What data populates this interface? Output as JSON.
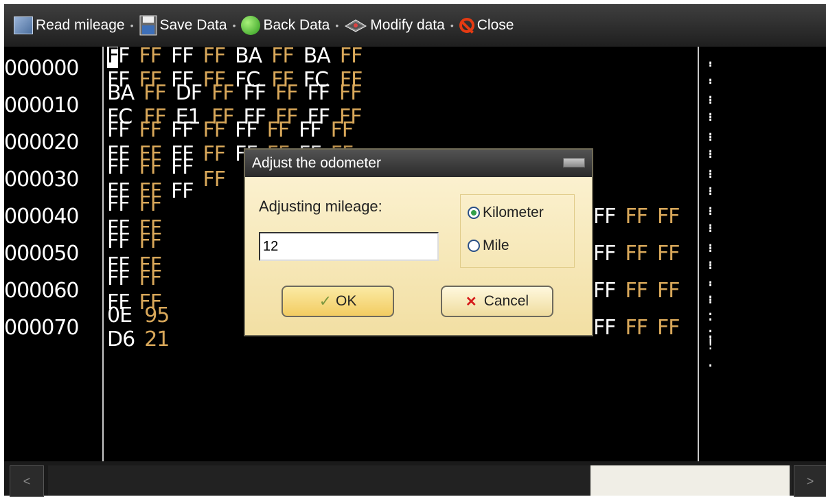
{
  "toolbar": {
    "items": [
      {
        "label": "Read mileage",
        "icon": "read-mileage-icon"
      },
      {
        "label": "Save Data",
        "icon": "floppy-disk-icon"
      },
      {
        "label": "Back Data",
        "icon": "green-refresh-icon"
      },
      {
        "label": "Modify data",
        "icon": "chip-icon"
      },
      {
        "label": "Close",
        "icon": "no-entry-icon"
      }
    ],
    "separator": "•"
  },
  "editor": {
    "rows": [
      {
        "addr": "000000",
        "bytes": [
          "FF",
          "FF",
          "FF",
          "FF",
          "FF",
          "FF",
          "FF",
          "FF",
          "BA",
          "FC",
          "FF",
          "FF",
          "BA",
          "FC",
          "FF",
          "FF"
        ],
        "ascii": "_ . . . . ."
      },
      {
        "addr": "000010",
        "bytes": [
          "BA",
          "FC",
          "FF",
          "FF",
          "DF",
          "E1",
          "FF",
          "FF",
          "FF",
          "FF",
          "FF",
          "FF",
          "FF",
          "FF",
          "FF",
          "FF"
        ],
        "ascii": ". . . . . ."
      },
      {
        "addr": "000020",
        "bytes": [
          "FF",
          "FF",
          "FF",
          "FF",
          "FF",
          "FF",
          "FF",
          "FF",
          "FF",
          "FF",
          "FF",
          "FF",
          "FF",
          "FF",
          "FF",
          "FF"
        ],
        "ascii": ". . . . . ."
      },
      {
        "addr": "000030",
        "bytes": [
          "FF",
          "FF",
          "FF",
          "FF",
          "",
          "",
          "",
          "",
          "",
          "",
          "",
          "",
          "",
          "",
          "FF",
          "FF",
          "FF"
        ],
        "ascii": ". . . . . ."
      },
      {
        "addr": "000040",
        "bytes": [
          "FF",
          "FF",
          "FF",
          "FF"
        ],
        "tail": [
          "FF",
          "FF",
          "FF"
        ],
        "ascii": ". . . . . ."
      },
      {
        "addr": "000050",
        "bytes": [
          "FF",
          "FF",
          "FF",
          "FF"
        ],
        "tail": [
          "FF",
          "FF",
          "FF"
        ],
        "ascii": ". . . . . ."
      },
      {
        "addr": "000060",
        "bytes": [
          "FF",
          "FF",
          "FF",
          "FF"
        ],
        "tail": [
          "FF",
          "FF",
          "FF"
        ],
        "ascii": ". . . . . ."
      },
      {
        "addr": "000070",
        "bytes": [
          "0E",
          "D6",
          "95",
          "21"
        ],
        "tail": [
          "FF",
          "FF",
          "FF"
        ],
        "ascii": ". . . ! ."
      }
    ],
    "cursor_char": "F"
  },
  "dialog": {
    "title": "Adjust the odometer",
    "label": "Adjusting mileage:",
    "input_value": "12",
    "options": [
      {
        "label": "Kilometer",
        "checked": true
      },
      {
        "label": "Mile",
        "checked": false
      }
    ],
    "ok_label": "OK",
    "cancel_label": "Cancel"
  },
  "scrollbar": {
    "left_arrow": "<",
    "right_arrow": ">"
  }
}
